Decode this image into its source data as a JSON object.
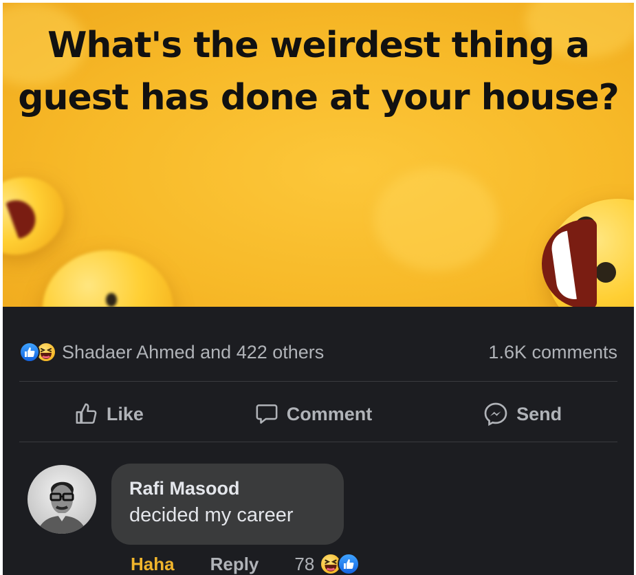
{
  "post": {
    "headline": "What's the weirdest thing a guest has done at your house?"
  },
  "reactions": {
    "icons": [
      "like-icon",
      "haha-icon"
    ],
    "summary": "Shadaer Ahmed and 422 others",
    "comments_count": "1.6K comments"
  },
  "actions": {
    "like": "Like",
    "comment": "Comment",
    "send": "Send"
  },
  "comment": {
    "author": "Rafi Masood",
    "text": "decided my career",
    "haha_label": "Haha",
    "reply_label": "Reply",
    "reaction_count": "78",
    "reaction_icons": [
      "haha-icon",
      "like-icon"
    ]
  },
  "colors": {
    "post_background": "#f7b928",
    "app_background": "#1c1d21",
    "secondary_text": "#b0b3b8",
    "bubble": "#3a3b3c",
    "haha_accent": "#f0b52c",
    "like_blue": "#1877f2"
  }
}
